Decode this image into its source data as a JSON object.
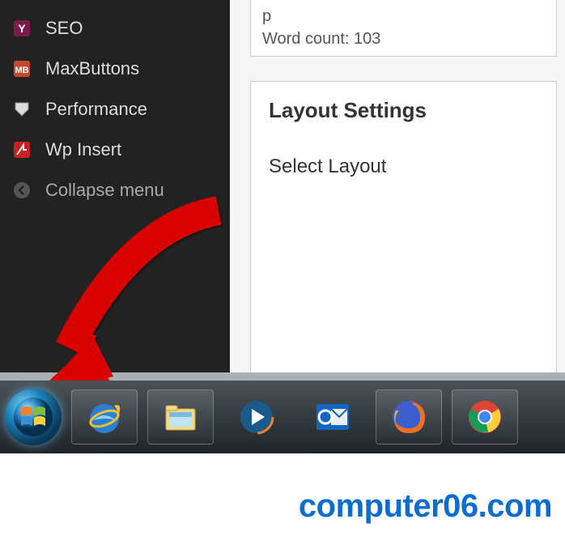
{
  "sidebar": {
    "items": [
      {
        "label": "SEO",
        "icon": "seo-icon"
      },
      {
        "label": "MaxButtons",
        "icon": "maxbuttons-icon"
      },
      {
        "label": "Performance",
        "icon": "performance-icon"
      },
      {
        "label": "Wp Insert",
        "icon": "wpinsert-icon"
      },
      {
        "label": "Collapse menu",
        "icon": "collapse-icon"
      }
    ]
  },
  "editor": {
    "tag_display": "p",
    "word_count_label": "Word count: 103"
  },
  "panel": {
    "heading": "Layout Settings",
    "select_label": "Select Layout"
  },
  "taskbar": {
    "items": [
      {
        "name": "start-button"
      },
      {
        "name": "internet-explorer"
      },
      {
        "name": "file-explorer"
      },
      {
        "name": "windows-media-player"
      },
      {
        "name": "outlook"
      },
      {
        "name": "firefox"
      },
      {
        "name": "chrome"
      }
    ]
  },
  "watermark": "computer06.com"
}
